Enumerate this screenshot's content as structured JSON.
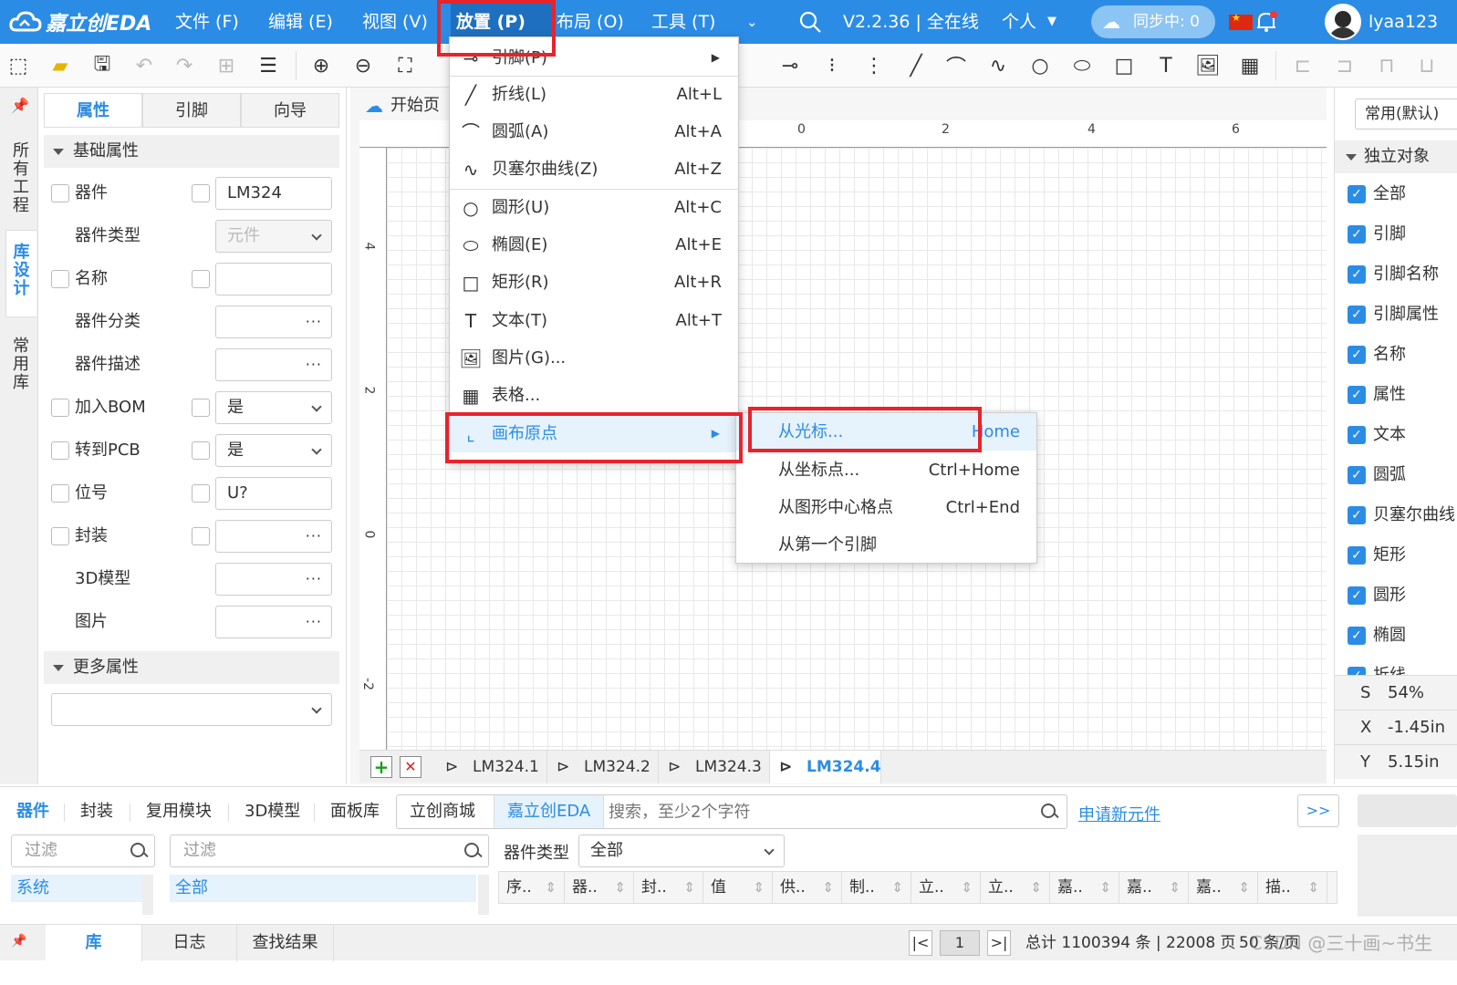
{
  "topbar": {
    "logo": "嘉立创EDA",
    "menus": [
      "文件 (F)",
      "编辑 (E)",
      "视图 (V)",
      "放置 (P)",
      "布局 (O)",
      "工具 (T)"
    ],
    "version": "V2.2.36 | 全在线",
    "mode": "个人",
    "sync": "同步中: 0",
    "username": "lyaa123"
  },
  "left_strip": {
    "tabs": [
      "所有工程",
      "库设计",
      "常用库"
    ]
  },
  "props": {
    "tabs": [
      "属性",
      "引脚",
      "向导"
    ],
    "section_basic": "基础属性",
    "rows": [
      {
        "label": "器件",
        "value": "LM324",
        "cb": true,
        "cb2": true
      },
      {
        "label": "器件类型",
        "value": "元件",
        "select": true
      },
      {
        "label": "名称",
        "value": "",
        "cb": true,
        "cb2": true
      },
      {
        "label": "器件分类",
        "value": "",
        "dots": "···"
      },
      {
        "label": "器件描述",
        "value": "",
        "dots": "···"
      },
      {
        "label": "加入BOM",
        "value": "是",
        "cb": true,
        "cb2": true,
        "select": true
      },
      {
        "label": "转到PCB",
        "value": "是",
        "cb": true,
        "cb2": true,
        "select": true
      },
      {
        "label": "位号",
        "value": "U?",
        "cb": true,
        "cb2": true
      },
      {
        "label": "封装",
        "value": "",
        "cb": true,
        "cb2": true,
        "dots": "···"
      },
      {
        "label": "3D模型",
        "value": "",
        "dots": "···"
      },
      {
        "label": "图片",
        "value": "",
        "dots": "···"
      }
    ],
    "section_more": "更多属性"
  },
  "canvas": {
    "start_tab": "开始页",
    "ruler_h": [
      "0",
      "2",
      "4",
      "6"
    ],
    "ruler_v": [
      "4",
      "2",
      "0",
      "-2"
    ],
    "doc_tabs": [
      "LM324.1",
      "LM324.2",
      "LM324.3",
      "LM324.4"
    ],
    "active_doc": "LM324.4"
  },
  "place_menu": {
    "items": [
      {
        "label": "引脚(P)",
        "shortcut": "",
        "submenu": true
      },
      {
        "label": "折线(L)",
        "shortcut": "Alt+L"
      },
      {
        "label": "圆弧(A)",
        "shortcut": "Alt+A"
      },
      {
        "label": "贝塞尔曲线(Z)",
        "shortcut": "Alt+Z"
      },
      {
        "label": "圆形(U)",
        "shortcut": "Alt+C"
      },
      {
        "label": "椭圆(E)",
        "shortcut": "Alt+E"
      },
      {
        "label": "矩形(R)",
        "shortcut": "Alt+R"
      },
      {
        "label": "文本(T)",
        "shortcut": "Alt+T"
      },
      {
        "label": "图片(G)...",
        "shortcut": ""
      },
      {
        "label": "表格...",
        "shortcut": ""
      },
      {
        "label": "画布原点",
        "shortcut": "",
        "submenu": true
      }
    ]
  },
  "origin_submenu": {
    "items": [
      {
        "label": "从光标...",
        "shortcut": "Home"
      },
      {
        "label": "从坐标点...",
        "shortcut": "Ctrl+Home"
      },
      {
        "label": "从图形中心格点",
        "shortcut": "Ctrl+End"
      },
      {
        "label": "从第一个引脚",
        "shortcut": ""
      }
    ]
  },
  "right_panel": {
    "select": "常用(默认)",
    "section": "独立对象",
    "items": [
      "全部",
      "引脚",
      "引脚名称",
      "引脚属性",
      "名称",
      "属性",
      "文本",
      "圆弧",
      "贝塞尔曲线",
      "矩形",
      "圆形",
      "椭圆",
      "折线"
    ],
    "stats": {
      "s_label": "S",
      "s_value": "54%",
      "x_label": "X",
      "x_value": "-1.45in",
      "y_label": "Y",
      "y_value": "5.15in"
    }
  },
  "bottom": {
    "tabs": [
      "器件",
      "封装",
      "复用模块",
      "3D模型",
      "面板库"
    ],
    "source_tabs": [
      "立创商城",
      "嘉立创EDA"
    ],
    "search_placeholder": "搜索，至少2个字符",
    "apply_link": "申请新元件",
    "expand": ">>",
    "filter1": "过滤",
    "filter2": "过滤",
    "type_label": "器件类型",
    "type_value": "全部",
    "tree1": "系统",
    "tree2": "全部",
    "columns": [
      "序..",
      "器..",
      "封..",
      "值",
      "供..",
      "制..",
      "立..",
      "立..",
      "嘉..",
      "嘉..",
      "嘉..",
      "描.."
    ],
    "status_tabs": [
      "库",
      "日志",
      "查找结果"
    ],
    "page": "1",
    "total": "总计 1100394 条 | 22008 页",
    "per_page": "50 条/页",
    "watermark": "CSDN @三十画~书生"
  },
  "colors": {
    "accent": "#2b8ce6",
    "highlight": "#e8232b"
  }
}
